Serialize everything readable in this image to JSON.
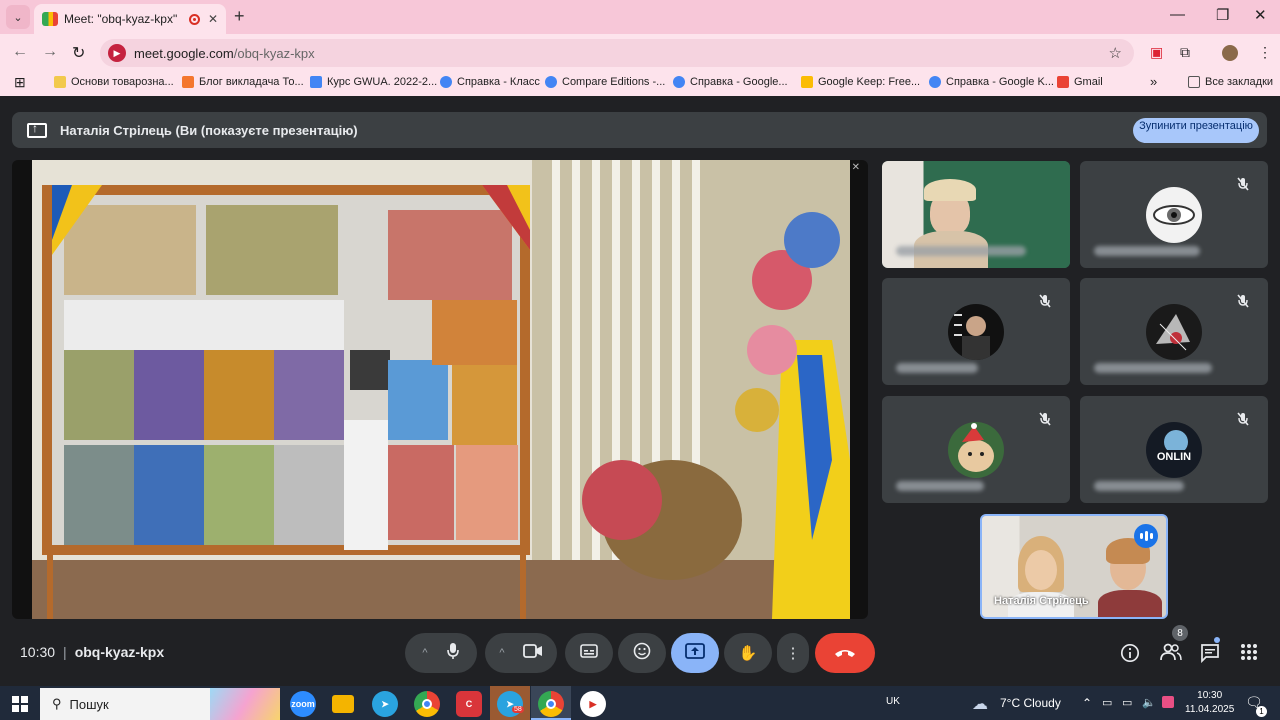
{
  "browser": {
    "tab_title": "Meet: \"obq-kyaz-kpx\"",
    "url_host": "meet.google.com",
    "url_path": "/obq-kyaz-kpx",
    "bookmarks": [
      {
        "label": "Основи товарозна...",
        "color": "#f2c94c"
      },
      {
        "label": "Блог викладача То...",
        "color": "#f4762d"
      },
      {
        "label": "Курс GWUA. 2022-2...",
        "color": "#4285f4"
      },
      {
        "label": "Справка - Класс",
        "color": "#4285f4"
      },
      {
        "label": "Compare Editions -...",
        "color": "#4285f4"
      },
      {
        "label": "Справка - Google...",
        "color": "#4285f4"
      },
      {
        "label": "Google Keep: Free...",
        "color": "#fbbc04"
      },
      {
        "label": "Справка - Google K...",
        "color": "#4285f4"
      },
      {
        "label": "Gmail",
        "color": "#ea4335"
      }
    ],
    "all_bookmarks_label": "Все закладки"
  },
  "meet": {
    "banner_text": "Наталія Стрілець (Ви (показуєте презентацію)",
    "stop_button_label": "Зупинити презентацію",
    "self_name": "Наталія Стрілець",
    "time": "10:30",
    "meeting_code": "obq-kyaz-kpx",
    "participant_count": "8",
    "accent": "#8ab4f8",
    "hangup_color": "#ea4335"
  },
  "taskbar": {
    "search_placeholder": "Пошук",
    "language": "UK",
    "weather": "7°C  Cloudy",
    "time": "10:30",
    "date": "11.04.2025",
    "notification_count": "1",
    "telegram_badge": "58"
  }
}
